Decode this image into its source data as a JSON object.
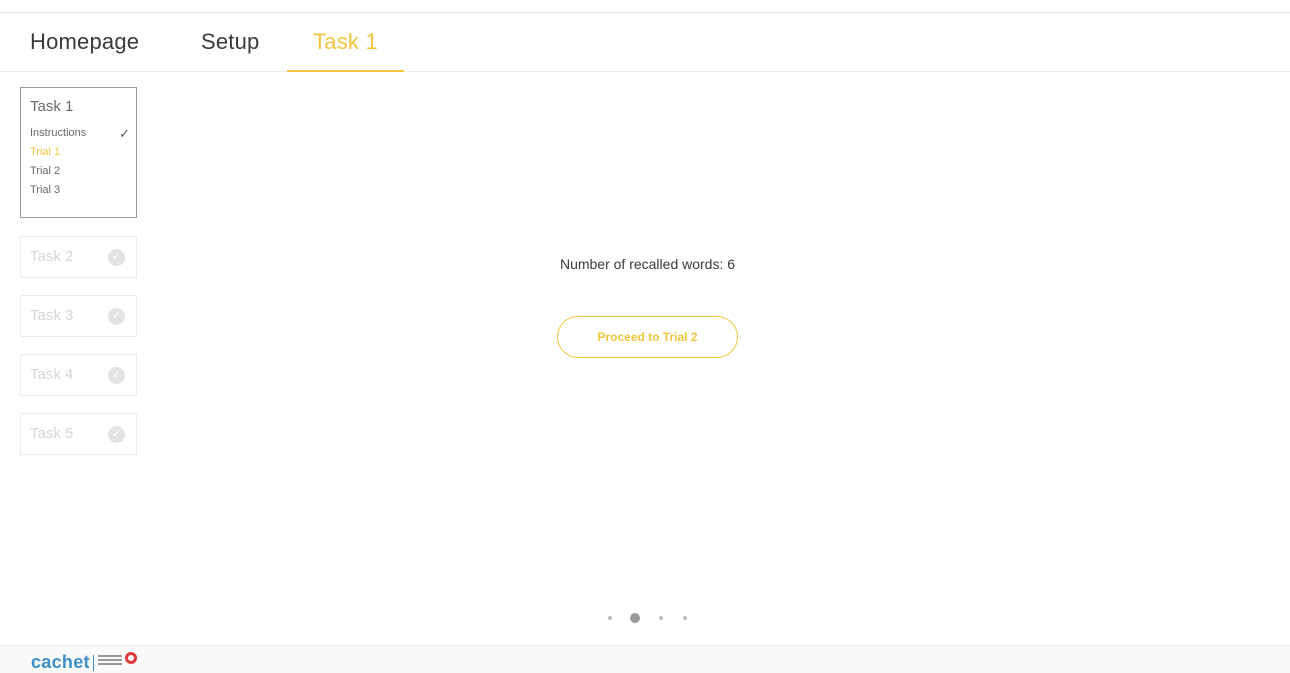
{
  "nav": {
    "tabs": [
      {
        "label": "Homepage"
      },
      {
        "label": "Setup"
      },
      {
        "label": "Task 1",
        "active": true
      }
    ]
  },
  "sidebar": {
    "active_task": {
      "title": "Task 1",
      "items": [
        {
          "label": "Instructions",
          "status": "completed",
          "icon": "check-icon"
        },
        {
          "label": "Trial 1",
          "status": "current"
        },
        {
          "label": "Trial 2"
        },
        {
          "label": "Trial 3"
        }
      ]
    },
    "locked_tasks": [
      {
        "label": "Task 2",
        "icon": "check-circle-icon"
      },
      {
        "label": "Task 3",
        "icon": "check-circle-icon"
      },
      {
        "label": "Task 4",
        "icon": "check-circle-icon"
      },
      {
        "label": "Task 5",
        "icon": "check-circle-icon"
      }
    ]
  },
  "main": {
    "result_text": "Number of recalled words: 6",
    "proceed_button": "Proceed to Trial 2"
  },
  "pager": {
    "count": 4,
    "active_index": 1
  },
  "footer": {
    "logo_text": "cachet"
  },
  "colors": {
    "accent": "#f2c53d",
    "text": "#3a3a3a",
    "logo_blue": "#3a8fc7",
    "logo_red": "#e0393e"
  }
}
